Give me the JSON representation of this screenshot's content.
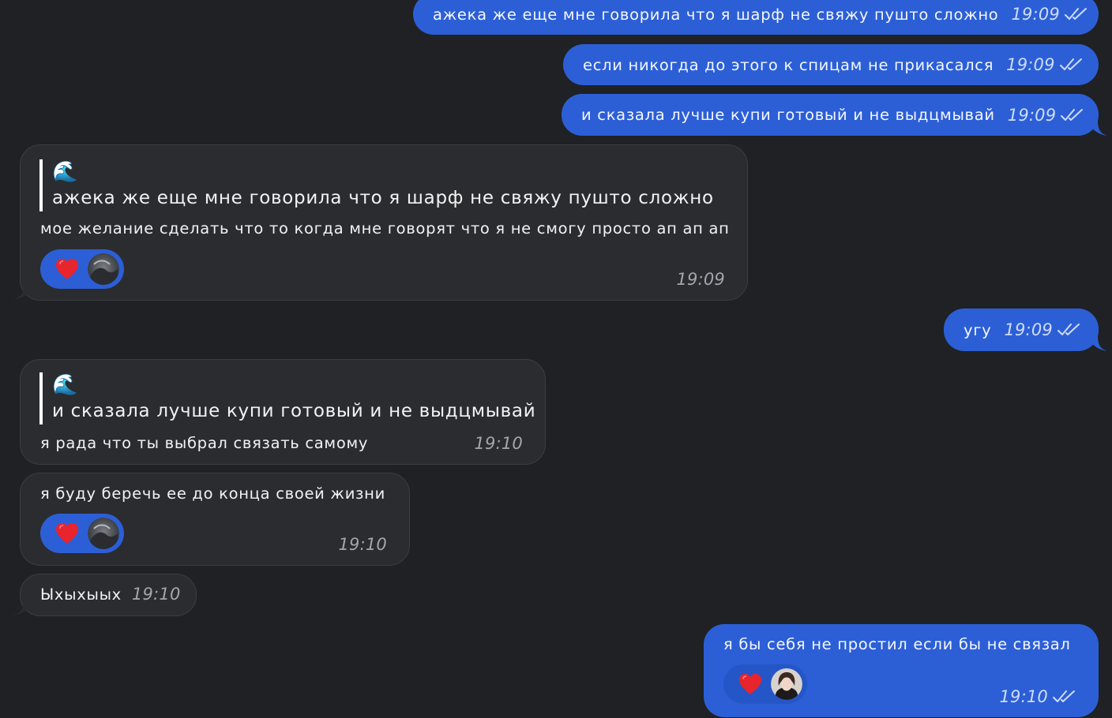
{
  "colors": {
    "background": "#1f2124",
    "outgoing_bubble": "#2c5fd6",
    "incoming_bubble": "#2b2c2f",
    "heart": "#e8242c"
  },
  "messages": [
    {
      "id": "m1",
      "dir": "out",
      "text": "ажека же еще мне говорила что я шарф не свяжу пушто сложно",
      "time": "19:09",
      "status_icon": "double-check-icon"
    },
    {
      "id": "m2",
      "dir": "out",
      "text": "если никогда до этого к спицам не прикасался",
      "time": "19:09",
      "status_icon": "double-check-icon"
    },
    {
      "id": "m3",
      "dir": "out",
      "text": "и сказала лучше купи готовый и не выдцмывай",
      "time": "19:09",
      "status_icon": "double-check-icon"
    },
    {
      "id": "m4",
      "dir": "in",
      "quote": {
        "emoji": "🌊",
        "text": "ажека же еще мне говорила что я шарф не свяжу пушто сложно"
      },
      "text": "мое желание сделать что то когда мне говорят что я не смогу просто ап ап ап",
      "time": "19:09",
      "reaction": {
        "icon": "heart-icon",
        "avatar": "reactor-avatar"
      }
    },
    {
      "id": "m5",
      "dir": "out",
      "text": "угу",
      "time": "19:09",
      "status_icon": "double-check-icon"
    },
    {
      "id": "m6",
      "dir": "in",
      "quote": {
        "emoji": "🌊",
        "text": "и сказала лучше купи готовый и не выдцмывай"
      },
      "text": "я рада что ты выбрал связать самому",
      "time": "19:10"
    },
    {
      "id": "m7",
      "dir": "in",
      "text": "я буду беречь ее до конца своей жизни",
      "time": "19:10",
      "reaction": {
        "icon": "heart-icon",
        "avatar": "reactor-avatar"
      }
    },
    {
      "id": "m8",
      "dir": "in",
      "text": "Ыхыхыых",
      "time": "19:10"
    },
    {
      "id": "m9",
      "dir": "out",
      "text": "я бы себя не простил если бы не связал",
      "time": "19:10",
      "status_icon": "double-check-icon",
      "reaction": {
        "icon": "heart-icon",
        "avatar": "reactor-avatar"
      }
    }
  ]
}
